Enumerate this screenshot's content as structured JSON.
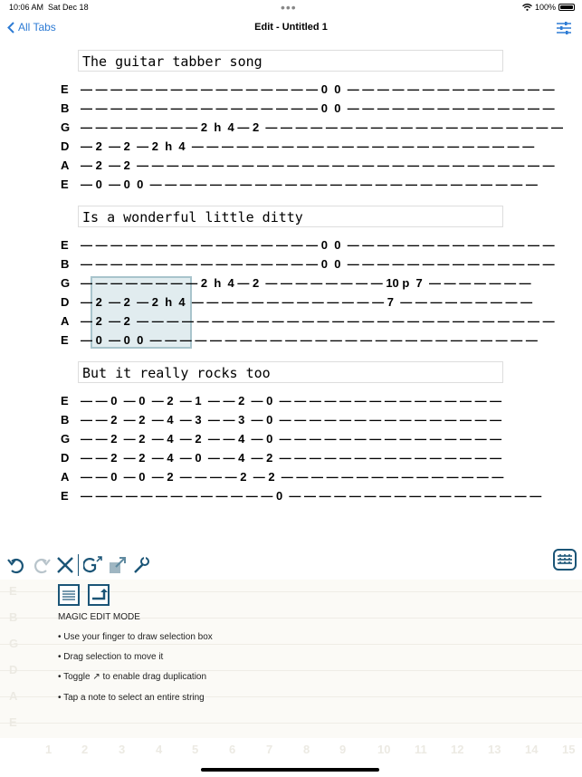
{
  "status": {
    "time": "10:06 AM",
    "date": "Sat Dec 18",
    "battery": "100%"
  },
  "nav": {
    "back_label": "All Tabs",
    "title": "Edit - Untitled 1"
  },
  "strings": [
    "E",
    "B",
    "G",
    "D",
    "A",
    "E"
  ],
  "sections": [
    {
      "lyric": "The guitar tabber song",
      "lines": [
        "— — — — — — — — — — — — — — — — 0  0  — — — — — — — — — — — — — —",
        "— — — — — — — — — — — — — — — — 0  0  — — — — — — — — — — — — — —",
        "— — — — — — — — 2  h  4 — 2  — — — — — — — — — — — — — — — — — — — —",
        "— 2  — 2  — 2  h  4  — — — — — — — — — — — — — — — — — — — — — — —",
        "— 2  — 2  — — — — — — — — — — — — — — — — — — — — — — — — — — — —",
        "— 0  — 0  0  — — — — — — — — — — — — — — — — — — — — — — — — — —"
      ]
    },
    {
      "lyric": "Is a wonderful little ditty",
      "lines": [
        "— — — — — — — — — — — — — — — — 0  0  — — — — — — — — — — — — — —",
        "— — — — — — — — — — — — — — — — 0  0  — — — — — — — — — — — — — —",
        "— — — — — — — — 2  h  4 — 2  — — — — — — — — 10 p  7  — — — — — — —",
        "— 2  — 2  — 2  h  4  — — — — — — — — — — — — — 7  — — — — — — — — —",
        "— 2  — 2  — — — — — — — — — — — — — — — — — — — — — — — — — — — —",
        "— 0  — 0  0  — — — — — — — — — — — — — — — — — — — — — — — — — —"
      ]
    },
    {
      "lyric": "But it really rocks too",
      "lines": [
        "— — 0  — 0  — 2  — 1  — — 2  — 0  — — — — — — — — — — — — — — —",
        "— — 2  — 2  — 4  — 3  — — 3  — 0  — — — — — — — — — — — — — — —",
        "— — 2  — 2  — 4  — 2  — — 4  — 0  — — — — — — — — — — — — — — —",
        "— — 2  — 2  — 4  — 0  — — 4  — 2  — — — — — — — — — — — — — — —",
        "— — 0  — 0  — 2  — — — — 2  — 2  — — — — — — — — — — — — — — —",
        "— — — — — — — — — — — — — 0  — — — — — — — — — — — — — — — — —"
      ]
    }
  ],
  "panel": {
    "mode_title": "MAGIC EDIT MODE",
    "tips": [
      "• Use your finger to draw selection box",
      "• Drag selection to move it",
      "• Toggle ↗ to enable drag duplication",
      "• Tap a note to select an entire string"
    ],
    "fret_numbers": [
      "1",
      "2",
      "3",
      "4",
      "5",
      "6",
      "7",
      "8",
      "9",
      "10",
      "11",
      "12",
      "13",
      "14",
      "15"
    ]
  },
  "colors": {
    "accent": "#2d7bd4",
    "tool": "#1b5577",
    "selection": "#c8dce1"
  }
}
